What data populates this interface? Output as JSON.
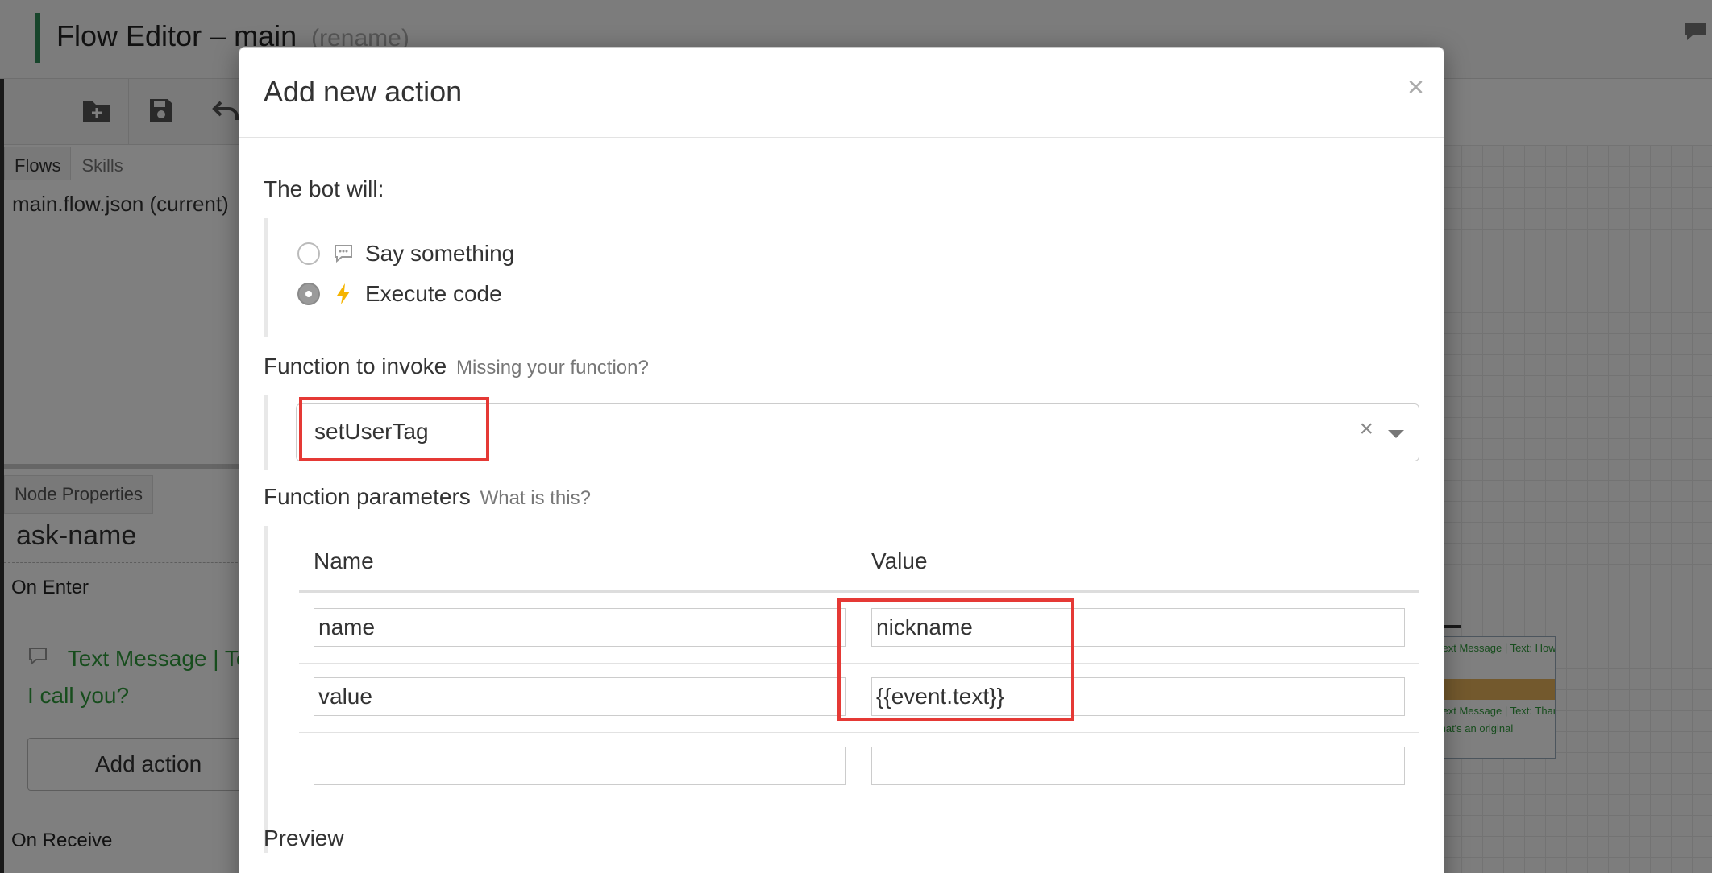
{
  "app": {
    "title": "Flow Editor – main",
    "rename_label": "(rename)"
  },
  "sidebar": {
    "tabs": [
      "Flows",
      "Skills"
    ],
    "file": "main.flow.json (current)"
  },
  "node_properties": {
    "tab_label": "Node Properties",
    "node_name": "ask-name",
    "on_enter_label": "On Enter",
    "message_line1": "Text Message | Text: How should",
    "message_line2": "I call you?",
    "add_action_label": "Add action",
    "on_receive_label": "On Receive"
  },
  "canvas_node": {
    "line1": "Text Message | Text: How",
    "line2": "Text Message | Text: Thanks,",
    "line3": "that's an original"
  },
  "modal": {
    "title": "Add new action",
    "close_symbol": "×",
    "bot_will_label": "The bot will:",
    "options": [
      {
        "label": "Say something",
        "icon": "speech-bubble-icon",
        "checked": false
      },
      {
        "label": "Execute code",
        "icon": "lightning-icon",
        "checked": true
      }
    ],
    "function_label": "Function to invoke",
    "function_hint": "Missing your function?",
    "selected_function": "setUserTag",
    "clear_symbol": "×",
    "params_label": "Function parameters",
    "params_hint": "What is this?",
    "table": {
      "headers": [
        "Name",
        "Value"
      ],
      "rows": [
        {
          "name": "name",
          "value": "nickname"
        },
        {
          "name": "value",
          "value": "{{event.text}}"
        },
        {
          "name": "",
          "value": ""
        }
      ]
    },
    "preview_label": "Preview"
  },
  "colors": {
    "highlight": "#e53935",
    "message_green": "#2e9a3a",
    "accent": "#2e8b57",
    "lightning": "#f5b400"
  }
}
